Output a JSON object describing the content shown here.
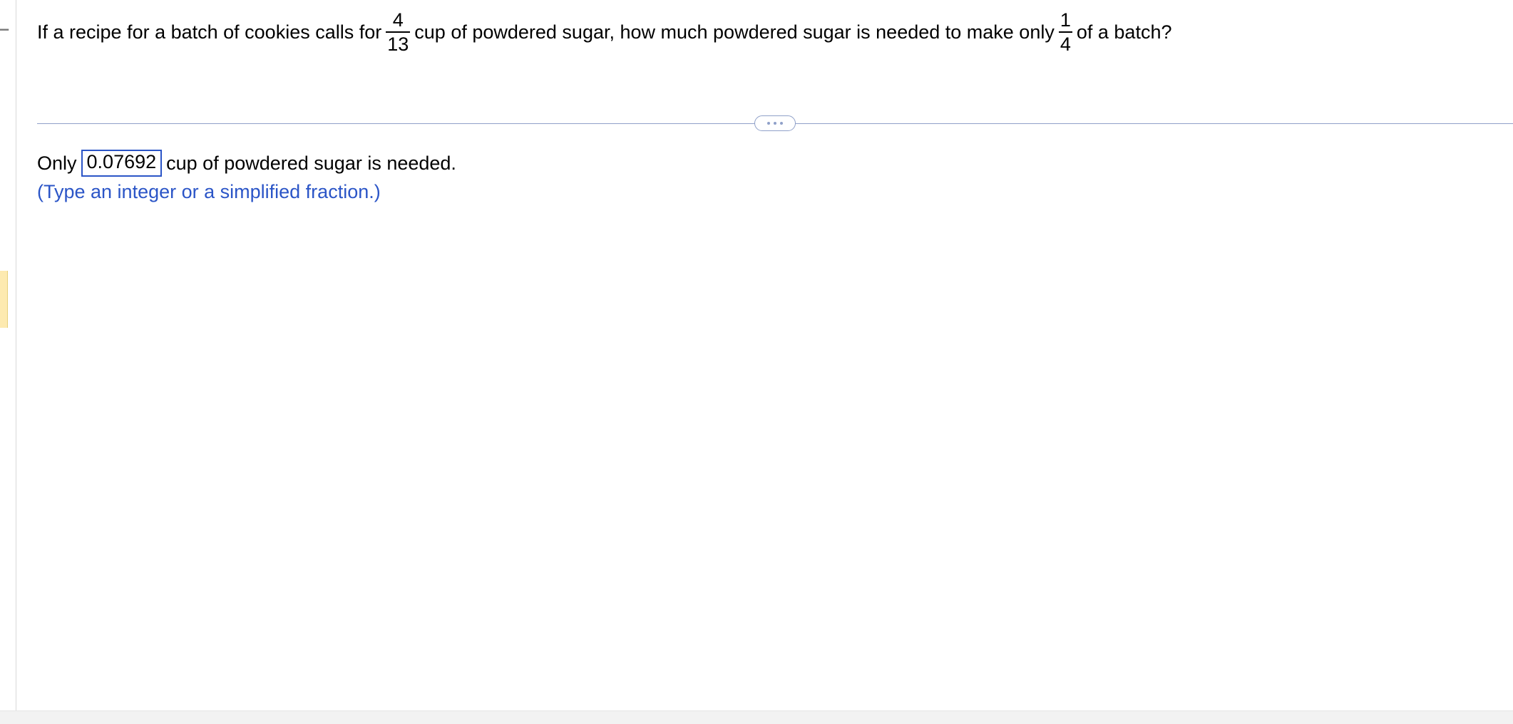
{
  "question": {
    "part1": "If a recipe for a batch of cookies calls for ",
    "frac1": {
      "num": "4",
      "den": "13"
    },
    "part2": " cup of powdered sugar, how much powdered sugar is needed to make only ",
    "frac2": {
      "num": "1",
      "den": "4"
    },
    "part3": " of a batch?"
  },
  "answer": {
    "prefix": "Only ",
    "value": "0.07692",
    "suffix": " cup of powdered sugar is needed.",
    "hint": "(Type an integer or a simplified fraction.)"
  },
  "left_sidebar": {
    "toggle_glyph": "−"
  }
}
